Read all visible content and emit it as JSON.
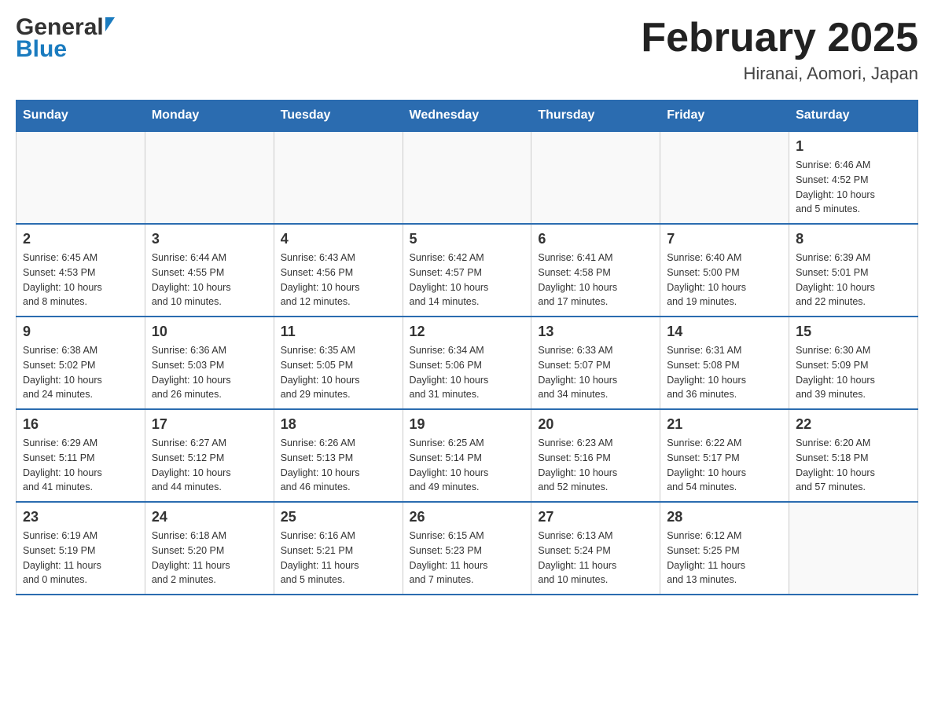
{
  "header": {
    "logo_general": "General",
    "logo_blue": "Blue",
    "month_title": "February 2025",
    "location": "Hiranai, Aomori, Japan"
  },
  "weekdays": [
    "Sunday",
    "Monday",
    "Tuesday",
    "Wednesday",
    "Thursday",
    "Friday",
    "Saturday"
  ],
  "weeks": [
    [
      {
        "day": "",
        "info": ""
      },
      {
        "day": "",
        "info": ""
      },
      {
        "day": "",
        "info": ""
      },
      {
        "day": "",
        "info": ""
      },
      {
        "day": "",
        "info": ""
      },
      {
        "day": "",
        "info": ""
      },
      {
        "day": "1",
        "info": "Sunrise: 6:46 AM\nSunset: 4:52 PM\nDaylight: 10 hours\nand 5 minutes."
      }
    ],
    [
      {
        "day": "2",
        "info": "Sunrise: 6:45 AM\nSunset: 4:53 PM\nDaylight: 10 hours\nand 8 minutes."
      },
      {
        "day": "3",
        "info": "Sunrise: 6:44 AM\nSunset: 4:55 PM\nDaylight: 10 hours\nand 10 minutes."
      },
      {
        "day": "4",
        "info": "Sunrise: 6:43 AM\nSunset: 4:56 PM\nDaylight: 10 hours\nand 12 minutes."
      },
      {
        "day": "5",
        "info": "Sunrise: 6:42 AM\nSunset: 4:57 PM\nDaylight: 10 hours\nand 14 minutes."
      },
      {
        "day": "6",
        "info": "Sunrise: 6:41 AM\nSunset: 4:58 PM\nDaylight: 10 hours\nand 17 minutes."
      },
      {
        "day": "7",
        "info": "Sunrise: 6:40 AM\nSunset: 5:00 PM\nDaylight: 10 hours\nand 19 minutes."
      },
      {
        "day": "8",
        "info": "Sunrise: 6:39 AM\nSunset: 5:01 PM\nDaylight: 10 hours\nand 22 minutes."
      }
    ],
    [
      {
        "day": "9",
        "info": "Sunrise: 6:38 AM\nSunset: 5:02 PM\nDaylight: 10 hours\nand 24 minutes."
      },
      {
        "day": "10",
        "info": "Sunrise: 6:36 AM\nSunset: 5:03 PM\nDaylight: 10 hours\nand 26 minutes."
      },
      {
        "day": "11",
        "info": "Sunrise: 6:35 AM\nSunset: 5:05 PM\nDaylight: 10 hours\nand 29 minutes."
      },
      {
        "day": "12",
        "info": "Sunrise: 6:34 AM\nSunset: 5:06 PM\nDaylight: 10 hours\nand 31 minutes."
      },
      {
        "day": "13",
        "info": "Sunrise: 6:33 AM\nSunset: 5:07 PM\nDaylight: 10 hours\nand 34 minutes."
      },
      {
        "day": "14",
        "info": "Sunrise: 6:31 AM\nSunset: 5:08 PM\nDaylight: 10 hours\nand 36 minutes."
      },
      {
        "day": "15",
        "info": "Sunrise: 6:30 AM\nSunset: 5:09 PM\nDaylight: 10 hours\nand 39 minutes."
      }
    ],
    [
      {
        "day": "16",
        "info": "Sunrise: 6:29 AM\nSunset: 5:11 PM\nDaylight: 10 hours\nand 41 minutes."
      },
      {
        "day": "17",
        "info": "Sunrise: 6:27 AM\nSunset: 5:12 PM\nDaylight: 10 hours\nand 44 minutes."
      },
      {
        "day": "18",
        "info": "Sunrise: 6:26 AM\nSunset: 5:13 PM\nDaylight: 10 hours\nand 46 minutes."
      },
      {
        "day": "19",
        "info": "Sunrise: 6:25 AM\nSunset: 5:14 PM\nDaylight: 10 hours\nand 49 minutes."
      },
      {
        "day": "20",
        "info": "Sunrise: 6:23 AM\nSunset: 5:16 PM\nDaylight: 10 hours\nand 52 minutes."
      },
      {
        "day": "21",
        "info": "Sunrise: 6:22 AM\nSunset: 5:17 PM\nDaylight: 10 hours\nand 54 minutes."
      },
      {
        "day": "22",
        "info": "Sunrise: 6:20 AM\nSunset: 5:18 PM\nDaylight: 10 hours\nand 57 minutes."
      }
    ],
    [
      {
        "day": "23",
        "info": "Sunrise: 6:19 AM\nSunset: 5:19 PM\nDaylight: 11 hours\nand 0 minutes."
      },
      {
        "day": "24",
        "info": "Sunrise: 6:18 AM\nSunset: 5:20 PM\nDaylight: 11 hours\nand 2 minutes."
      },
      {
        "day": "25",
        "info": "Sunrise: 6:16 AM\nSunset: 5:21 PM\nDaylight: 11 hours\nand 5 minutes."
      },
      {
        "day": "26",
        "info": "Sunrise: 6:15 AM\nSunset: 5:23 PM\nDaylight: 11 hours\nand 7 minutes."
      },
      {
        "day": "27",
        "info": "Sunrise: 6:13 AM\nSunset: 5:24 PM\nDaylight: 11 hours\nand 10 minutes."
      },
      {
        "day": "28",
        "info": "Sunrise: 6:12 AM\nSunset: 5:25 PM\nDaylight: 11 hours\nand 13 minutes."
      },
      {
        "day": "",
        "info": ""
      }
    ]
  ],
  "colors": {
    "header_bg": "#2b6cb0",
    "header_text": "#ffffff",
    "border": "#2b6cb0"
  }
}
